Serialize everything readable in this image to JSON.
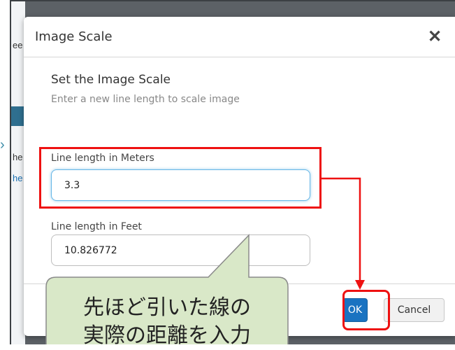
{
  "background": {
    "peek_fragments": [
      "ee",
      "he",
      "he"
    ]
  },
  "dialog": {
    "title": "Image Scale",
    "close_symbol": "✕",
    "heading": "Set the Image Scale",
    "subheading": "Enter a new line length to scale image",
    "fields": [
      {
        "label": "Line length in Meters",
        "value": "3.3",
        "focused": true
      },
      {
        "label": "Line length in Feet",
        "value": "10.826772",
        "focused": false
      }
    ],
    "buttons": {
      "ok": "OK",
      "cancel": "Cancel"
    }
  },
  "annotation": {
    "callout_lines": [
      "先ほど引いた線の",
      "実際の距離を入力"
    ],
    "highlight_color": "#e11111",
    "callout_fill": "#d9e8c8"
  }
}
